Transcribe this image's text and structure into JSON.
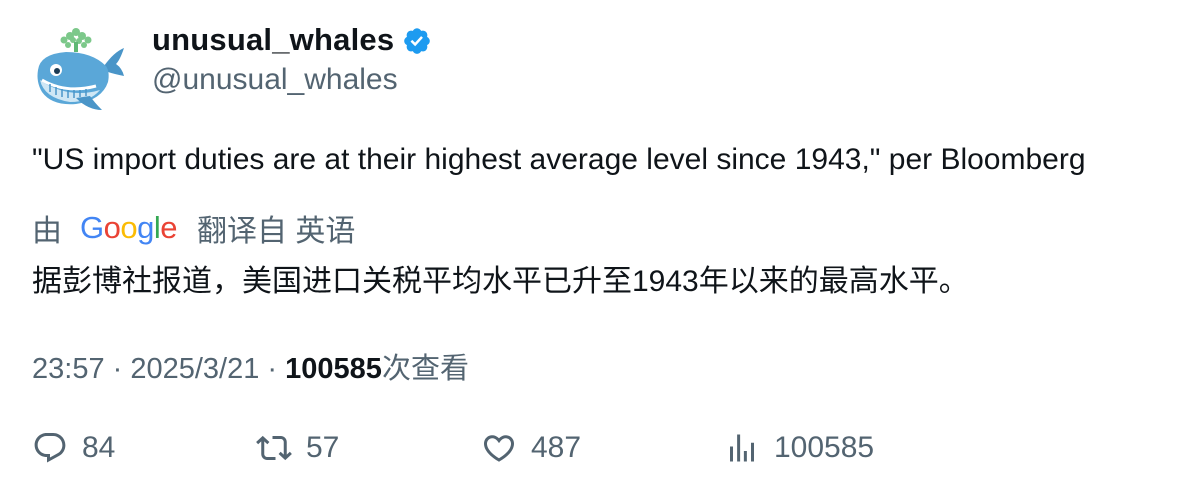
{
  "author": {
    "display_name": "unusual_whales",
    "handle": "@unusual_whales",
    "verified_icon": "verified-badge-icon",
    "avatar_icon": "whale-avatar-icon"
  },
  "tweet": {
    "text": "\"US import duties are at their highest average level since 1943,\" per Bloomberg"
  },
  "translation": {
    "by_label": "由",
    "provider": "Google",
    "translated_from_label": "翻译自 英语",
    "text": "据彭博社报道，美国进口关税平均水平已升至1943年以来的最高水平。"
  },
  "meta": {
    "time": "23:57",
    "separator": " · ",
    "date": "2025/3/21",
    "views_count": "100585",
    "views_label": "次查看"
  },
  "actions": {
    "replies": "84",
    "retweets": "57",
    "likes": "487",
    "views": "100585"
  },
  "colors": {
    "text_primary": "#0f1419",
    "text_secondary": "#536471",
    "verified_blue": "#1d9bf0"
  }
}
